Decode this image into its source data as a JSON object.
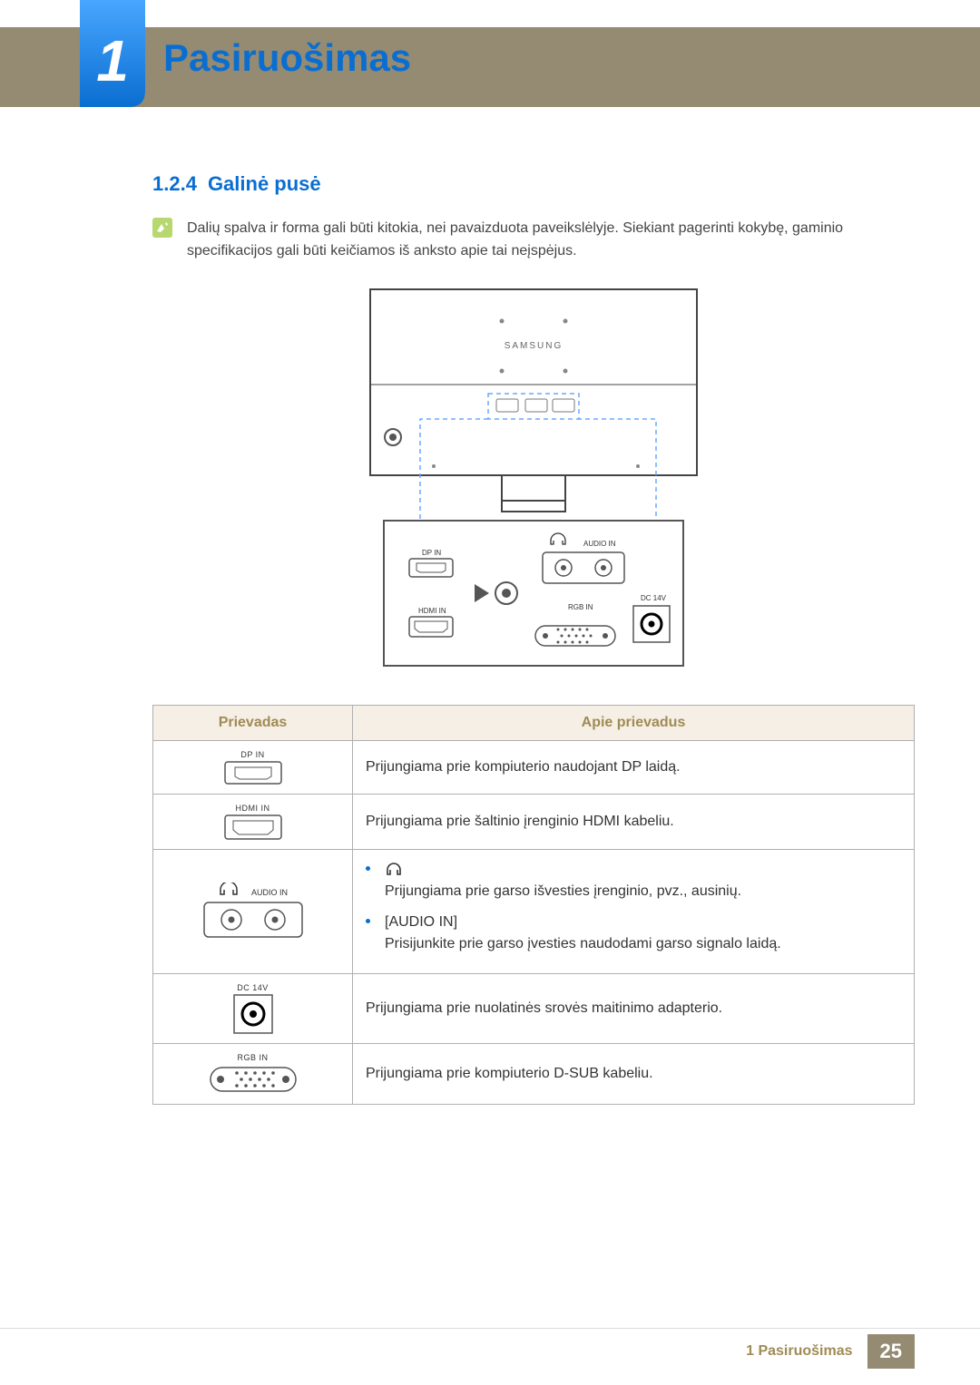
{
  "chapter": {
    "number": "1",
    "title": "Pasiruošimas"
  },
  "section": {
    "number": "1.2.4",
    "title": "Galinė pusė"
  },
  "note": "Dalių spalva ir forma gali būti kitokia, nei pavaizduota paveikslėlyje. Siekiant pagerinti kokybę, gaminio specifikacijos gali būti keičiamos iš anksto apie tai neįspėjus.",
  "diagram": {
    "brand": "SAMSUNG",
    "ports": {
      "dp": "DP IN",
      "hdmi": "HDMI IN",
      "audio_in": "AUDIO IN",
      "rgb": "RGB IN",
      "dc": "DC 14V"
    }
  },
  "table": {
    "headers": {
      "port": "Prievadas",
      "desc": "Apie prievadus"
    },
    "rows": [
      {
        "port_label": "DP IN",
        "port_kind": "dp",
        "desc_type": "text",
        "desc": "Prijungiama prie kompiuterio naudojant DP laidą."
      },
      {
        "port_label": "HDMI IN",
        "port_kind": "hdmi",
        "desc_type": "text",
        "desc": "Prijungiama prie šaltinio įrenginio HDMI kabeliu."
      },
      {
        "port_label": "AUDIO IN",
        "port_kind": "audio",
        "desc_type": "list",
        "items": [
          {
            "icon": "headphones",
            "text": "Prijungiama prie garso išvesties įrenginio, pvz., ausinių."
          },
          {
            "label": "[AUDIO IN]",
            "text": "Prisijunkite prie garso įvesties naudodami garso signalo laidą."
          }
        ]
      },
      {
        "port_label": "DC 14V",
        "port_kind": "dc",
        "desc_type": "text",
        "desc": "Prijungiama prie nuolatinės srovės maitinimo adapterio."
      },
      {
        "port_label": "RGB IN",
        "port_kind": "rgb",
        "desc_type": "text",
        "desc": "Prijungiama prie kompiuterio D-SUB kabeliu."
      }
    ]
  },
  "footer": {
    "text": "1 Pasiruošimas",
    "page": "25"
  }
}
